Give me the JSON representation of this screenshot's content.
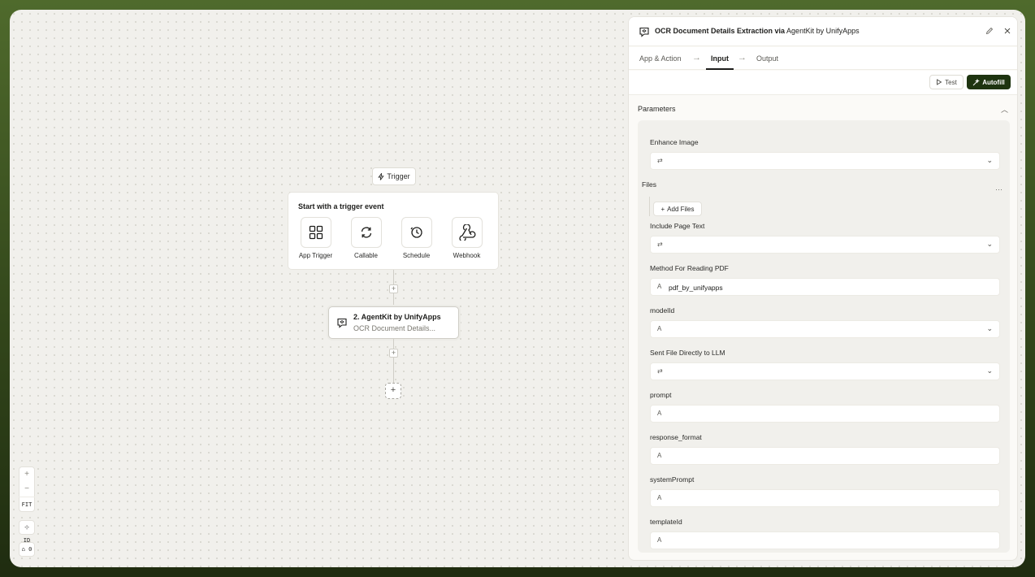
{
  "canvas": {
    "trigger_pill": "Trigger",
    "trigger_card": {
      "title": "Start with a trigger event",
      "options": [
        {
          "label": "App Trigger",
          "icon": "grid-icon"
        },
        {
          "label": "Callable",
          "icon": "refresh-icon"
        },
        {
          "label": "Schedule",
          "icon": "clock-icon"
        },
        {
          "label": "Webhook",
          "icon": "webhook-icon"
        }
      ]
    },
    "agent_node": {
      "title": "2. AgentKit by UnifyApps",
      "subtitle": "OCR Document Details..."
    },
    "plus": "+",
    "zoom": {
      "in": "+",
      "out": "−",
      "fit": "FIT"
    },
    "mini_controls": [
      "⊹ ID",
      "⌂ 0"
    ]
  },
  "panel": {
    "title_bold": "OCR Document Details Extraction via",
    "title_rest": " AgentKit by UnifyApps",
    "tabs": [
      "App & Action",
      "Input",
      "Output"
    ],
    "active_tab": "Input",
    "test_label": "Test",
    "autofill_label": "Autofill",
    "section_title": "Parameters",
    "fields": {
      "enhance_image": {
        "label": "Enhance Image",
        "value": ""
      },
      "files": {
        "label": "Files",
        "add_label": "Add Files"
      },
      "include_page_text": {
        "label": "Include Page Text",
        "value": ""
      },
      "method_pdf": {
        "label": "Method For Reading PDF",
        "value": "pdf_by_unifyapps"
      },
      "model_id": {
        "label": "modelId",
        "value": ""
      },
      "sent_file": {
        "label": "Sent File Directly to LLM",
        "value": ""
      },
      "prompt": {
        "label": "prompt",
        "value": ""
      },
      "response_format": {
        "label": "response_format",
        "value": ""
      },
      "system_prompt": {
        "label": "systemPrompt",
        "value": ""
      },
      "template_id": {
        "label": "templateId",
        "value": ""
      }
    }
  },
  "colors": {
    "accent_dark_green": "#1e3410",
    "canvas_bg": "#f1f0ec",
    "frame_green": "#4f6a2c"
  }
}
